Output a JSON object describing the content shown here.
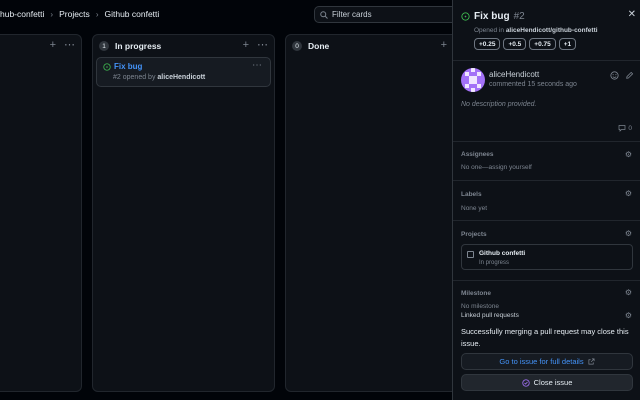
{
  "breadcrumb": {
    "org": "hub-confetti",
    "projects": "Projects",
    "project": "Github confetti",
    "sep": "›"
  },
  "search": {
    "placeholder": "Filter cards"
  },
  "columns": [
    {
      "count": "",
      "name": ""
    },
    {
      "count": "1",
      "name": "In progress"
    },
    {
      "count": "0",
      "name": "Done"
    }
  ],
  "column_actions": {
    "add": "+",
    "more": "⋯"
  },
  "card": {
    "title": "Fix bug",
    "number": "#2",
    "opened_text": "opened by",
    "author": "aliceHendicott",
    "menu": "⋯"
  },
  "panel": {
    "title": "Fix bug",
    "number": "#2",
    "opened_prefix": "Opened in",
    "repo": "aliceHendicott/github-confetti",
    "chips": [
      "+0.25",
      "+0.5",
      "+0.75",
      "+1"
    ],
    "close": "✕",
    "comment": {
      "author": "aliceHendicott",
      "time": "commented 15 seconds ago",
      "body": "No description provided.",
      "count": "0"
    },
    "assignees": {
      "heading": "Assignees",
      "value": "No one—assign yourself"
    },
    "labels": {
      "heading": "Labels",
      "value": "None yet"
    },
    "projects": {
      "heading": "Projects",
      "name": "Github confetti",
      "status": "In progress"
    },
    "milestone": {
      "heading": "Milestone",
      "value": "No milestone"
    },
    "linked": {
      "heading": "Linked pull requests"
    },
    "merge_note": "Successfully merging a pull request may close this issue.",
    "goto_button": "Go to issue for full details",
    "close_button": "Close issue"
  },
  "colors": {
    "open_green": "#3fb950",
    "link_blue": "#4493f8",
    "close_purple": "#a371f7"
  }
}
